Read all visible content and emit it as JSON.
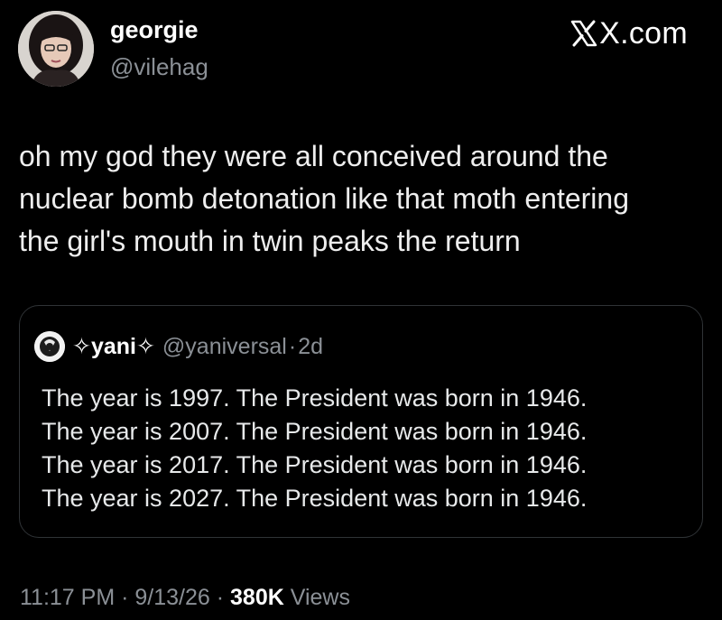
{
  "author": {
    "display_name": "georgie",
    "handle": "@vilehag",
    "avatar_icon": "profile-photo"
  },
  "brand": {
    "icon": "x-logo-icon",
    "label": "X.com"
  },
  "tweet": {
    "lines": [
      "oh my god they were all conceived around the",
      "nuclear bomb detonation like that moth entering",
      "the girl's mouth in twin peaks the return"
    ]
  },
  "quote": {
    "avatar_icon": "quote-avatar-icon",
    "display_name": "✧yani✧",
    "handle": "@yaniversal",
    "separator": "·",
    "time": "2d",
    "lines": [
      "The year is 1997. The President was born in 1946.",
      "The year is 2007. The President was born in 1946.",
      "The year is 2017. The President was born in 1946.",
      "The year is 2027. The President was born in 1946."
    ]
  },
  "meta": {
    "time": "11:17 PM",
    "sep1": " · ",
    "date": "9/13/26",
    "sep2": " · ",
    "views_count": "380K",
    "views_label": " Views"
  },
  "colors": {
    "background": "#000000",
    "primary_text": "#e7e9ea",
    "secondary_text": "#8b9096",
    "card_border": "#2f3336"
  }
}
